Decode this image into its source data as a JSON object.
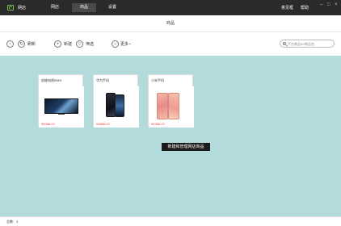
{
  "app": {
    "name": "网店"
  },
  "nav": [
    {
      "label": "网店",
      "active": false
    },
    {
      "label": "商品",
      "active": true
    },
    {
      "label": "设置",
      "active": false
    }
  ],
  "top_right": {
    "feedback": "意见框",
    "help": "帮助"
  },
  "window_controls": {
    "minimize": "–",
    "maximize": "□",
    "close": "×"
  },
  "page": {
    "title": "商品"
  },
  "toolbar": {
    "refresh_label": "刷新",
    "new_label": "新建",
    "filter_label": "筛选",
    "more_label": "更多",
    "search_placeholder": "平台商品ID/商品名"
  },
  "products": [
    {
      "title": "创维电视55E9",
      "price": "¥5088.00",
      "image_icon": "tv-image"
    },
    {
      "title": "华为手机",
      "price": "¥3888.00",
      "image_icon": "phone-image-huawei"
    },
    {
      "title": "小米手机",
      "price": "¥4388.00",
      "image_icon": "phone-image-xiaomi"
    }
  ],
  "tooltip": {
    "text": "新建和管理网店商品"
  },
  "status": {
    "label": "总数：3"
  },
  "colors": {
    "topbar": "#2a2a2a",
    "accent_green": "#7ac143",
    "content_bg": "#b3dbdc",
    "price_red": "#e64b4b"
  }
}
